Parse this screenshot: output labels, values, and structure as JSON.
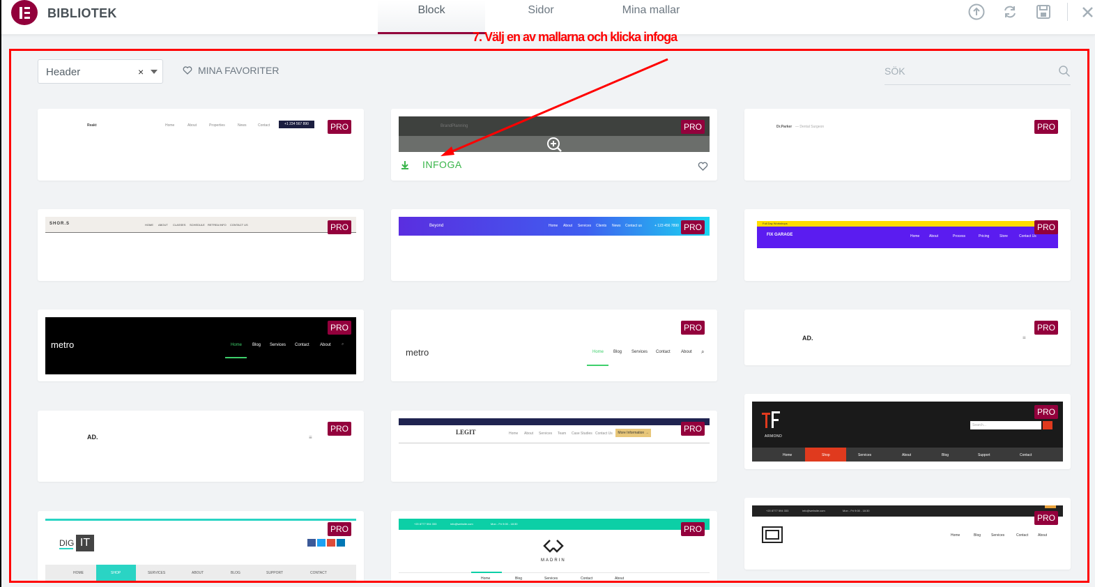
{
  "header": {
    "brand": "BIBLIOTEK",
    "tabs": [
      {
        "label": "Block"
      },
      {
        "label": "Sidor"
      },
      {
        "label": "Mina mallar"
      }
    ]
  },
  "annotation": {
    "text": "7. Välj en av mallarna och klicka infoga"
  },
  "filter": {
    "value": "Header",
    "clear": "×"
  },
  "favorites": {
    "label": "MINA FAVORITER"
  },
  "search": {
    "placeholder": "SÖK"
  },
  "pro_label": "PRO",
  "insert_label": "INFOGA",
  "colors": {
    "accent": "#92003b",
    "pro": "#93003c",
    "insert": "#39b54a",
    "annotation": "#ff0000"
  },
  "templates": {
    "t1": {
      "logo": "Reakt",
      "nav": [
        "Home",
        "About",
        "Properties",
        "News",
        "Contact"
      ],
      "cta": "+1 234 567 890"
    },
    "t2": {
      "logo": "BrandPlanning"
    },
    "t3": {
      "logo": "Dr.Parker",
      "tagline": "— Dental Surgeon"
    },
    "t4": {
      "logo": "SHOR.S",
      "nav": [
        "HOME",
        "ABOUT",
        "CLASSES",
        "SCHEDULE",
        "RETREA INFO",
        "CONTACT US"
      ]
    },
    "t5": {
      "logo": "Beyond",
      "nav": [
        "Home",
        "About",
        "Services",
        "Clients",
        "News",
        "Contact us"
      ],
      "phone": "+ 123 456 7890"
    },
    "t6": {
      "top": "Full Day Workshops",
      "logo": "FIX GARAGE",
      "nav": [
        "Home",
        "About",
        "Process",
        "Pricing",
        "Store",
        "Contact Us"
      ]
    },
    "t7": {
      "logo": "metro",
      "nav": [
        "Home",
        "Blog",
        "Services",
        "Contact",
        "About"
      ]
    },
    "t8": {
      "logo": "metro",
      "nav": [
        "Home",
        "Blog",
        "Services",
        "Contact",
        "About"
      ]
    },
    "t9": {
      "logo": "AD."
    },
    "t10": {
      "logo": "AD."
    },
    "t11": {
      "logo": "LEGIT",
      "nav": [
        "Home",
        "About",
        "Services",
        "Team",
        "Case Studies",
        "Contact Us"
      ],
      "cta": "More Information →"
    },
    "t12": {
      "brand": "ARMOND",
      "search": "Search...",
      "nav": [
        "Home",
        "Shop",
        "Services",
        "About",
        "Blog",
        "Support",
        "Contact"
      ]
    },
    "t13": {
      "logo_a": "DIG",
      "logo_b": "IT",
      "nav": [
        "HOME",
        "SHOP",
        "SERVICES",
        "ABOUT",
        "BLOG",
        "SUPPORT",
        "CONTACT"
      ]
    },
    "t14": {
      "phone": "+20 8777 594 333",
      "email": "info@website.com",
      "hours": "Mon - Fri 9:00 - 18:30",
      "logo": "MADRIN",
      "nav": [
        "Home",
        "Blog",
        "Services",
        "Contact",
        "About"
      ]
    },
    "t15": {
      "phone": "+20 8777 594 333",
      "email": "info@website.com",
      "hours": "Mon - Fri 9:00 - 18:30",
      "nav": [
        "Home",
        "Blog",
        "Services",
        "Contact",
        "About"
      ]
    }
  }
}
